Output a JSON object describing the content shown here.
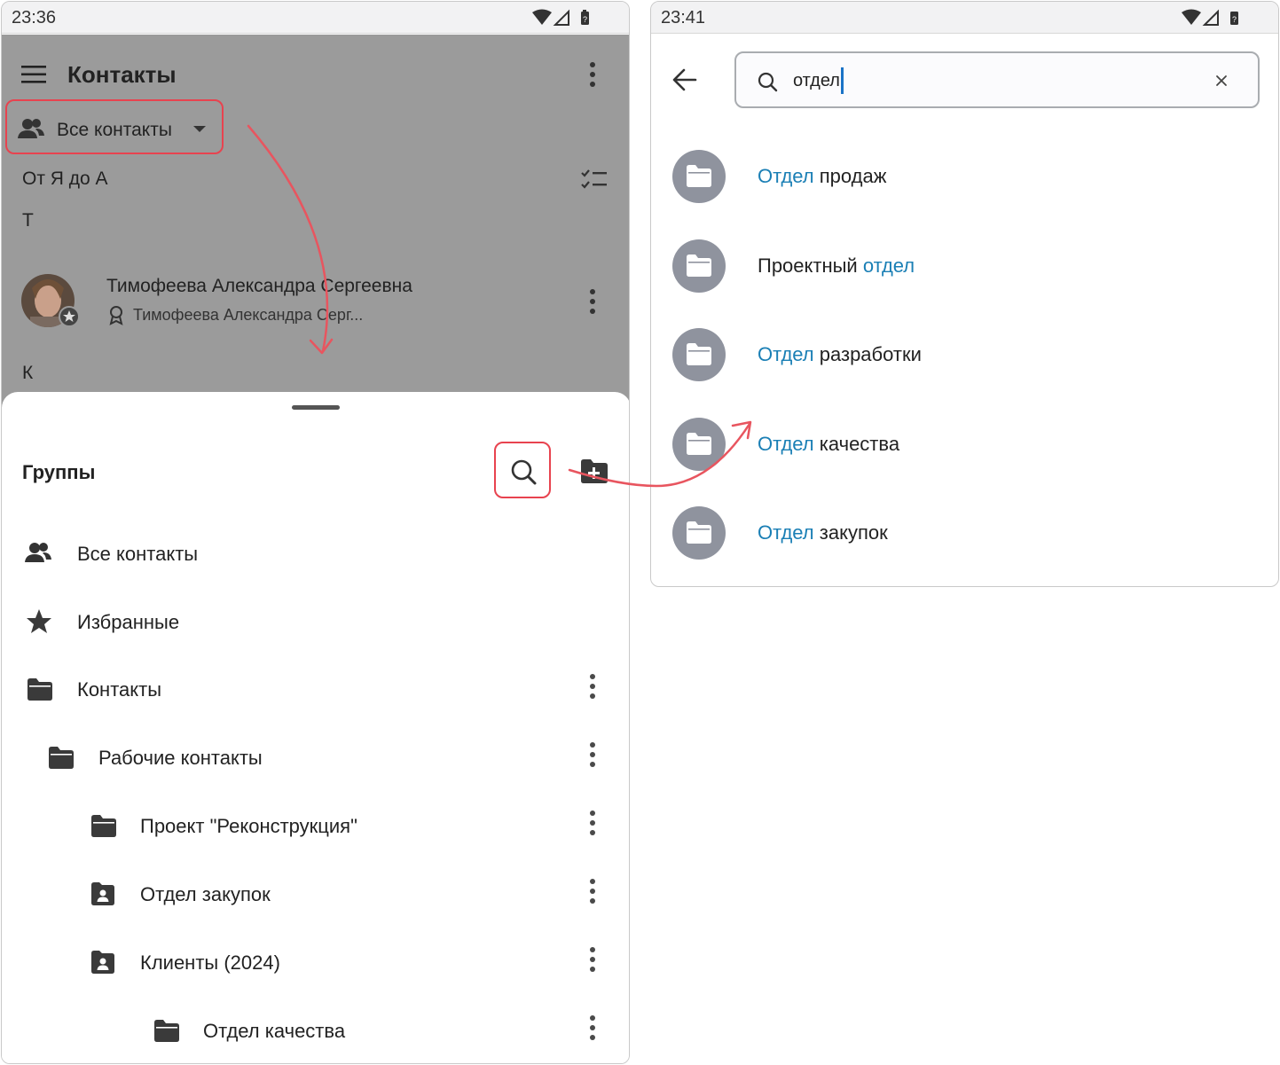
{
  "left_screen": {
    "status_time": "23:36",
    "app_title": "Контакты",
    "filter_chip_label": "Все контакты",
    "sort_label": "От Я до А",
    "section_t": "Т",
    "contact": {
      "name": "Тимофеева Александра Сергеевна",
      "subtitle": "Тимофеева Александра Серг..."
    },
    "section_k": "К",
    "sheet": {
      "title": "Группы",
      "items": [
        {
          "label": "Все контакты",
          "icon": "people-icon"
        },
        {
          "label": "Избранные",
          "icon": "star-icon"
        },
        {
          "label": "Контакты",
          "icon": "folder-icon"
        },
        {
          "label": "Рабочие контакты",
          "icon": "folder-icon"
        },
        {
          "label": "Проект \"Реконструкция\"",
          "icon": "folder-icon"
        },
        {
          "label": "Отдел закупок",
          "icon": "shared-folder-icon"
        },
        {
          "label": "Клиенты (2024)",
          "icon": "shared-folder-icon"
        },
        {
          "label": "Отдел качества",
          "icon": "folder-icon"
        }
      ]
    }
  },
  "right_screen": {
    "status_time": "23:41",
    "search_value": "отдел",
    "results": [
      {
        "match": "Отдел",
        "rest": " продаж"
      },
      {
        "prefix": "Проектный ",
        "match": "отдел"
      },
      {
        "match": "Отдел",
        "rest": " разработки"
      },
      {
        "match": "Отдел",
        "rest": " качества"
      },
      {
        "match": "Отдел",
        "rest": " закупок"
      }
    ]
  },
  "colors": {
    "highlight_border": "#e8434f",
    "match_text": "#1a7fb5",
    "dim_overlay": "#9b9b9b",
    "result_avatar": "#8f939e"
  }
}
